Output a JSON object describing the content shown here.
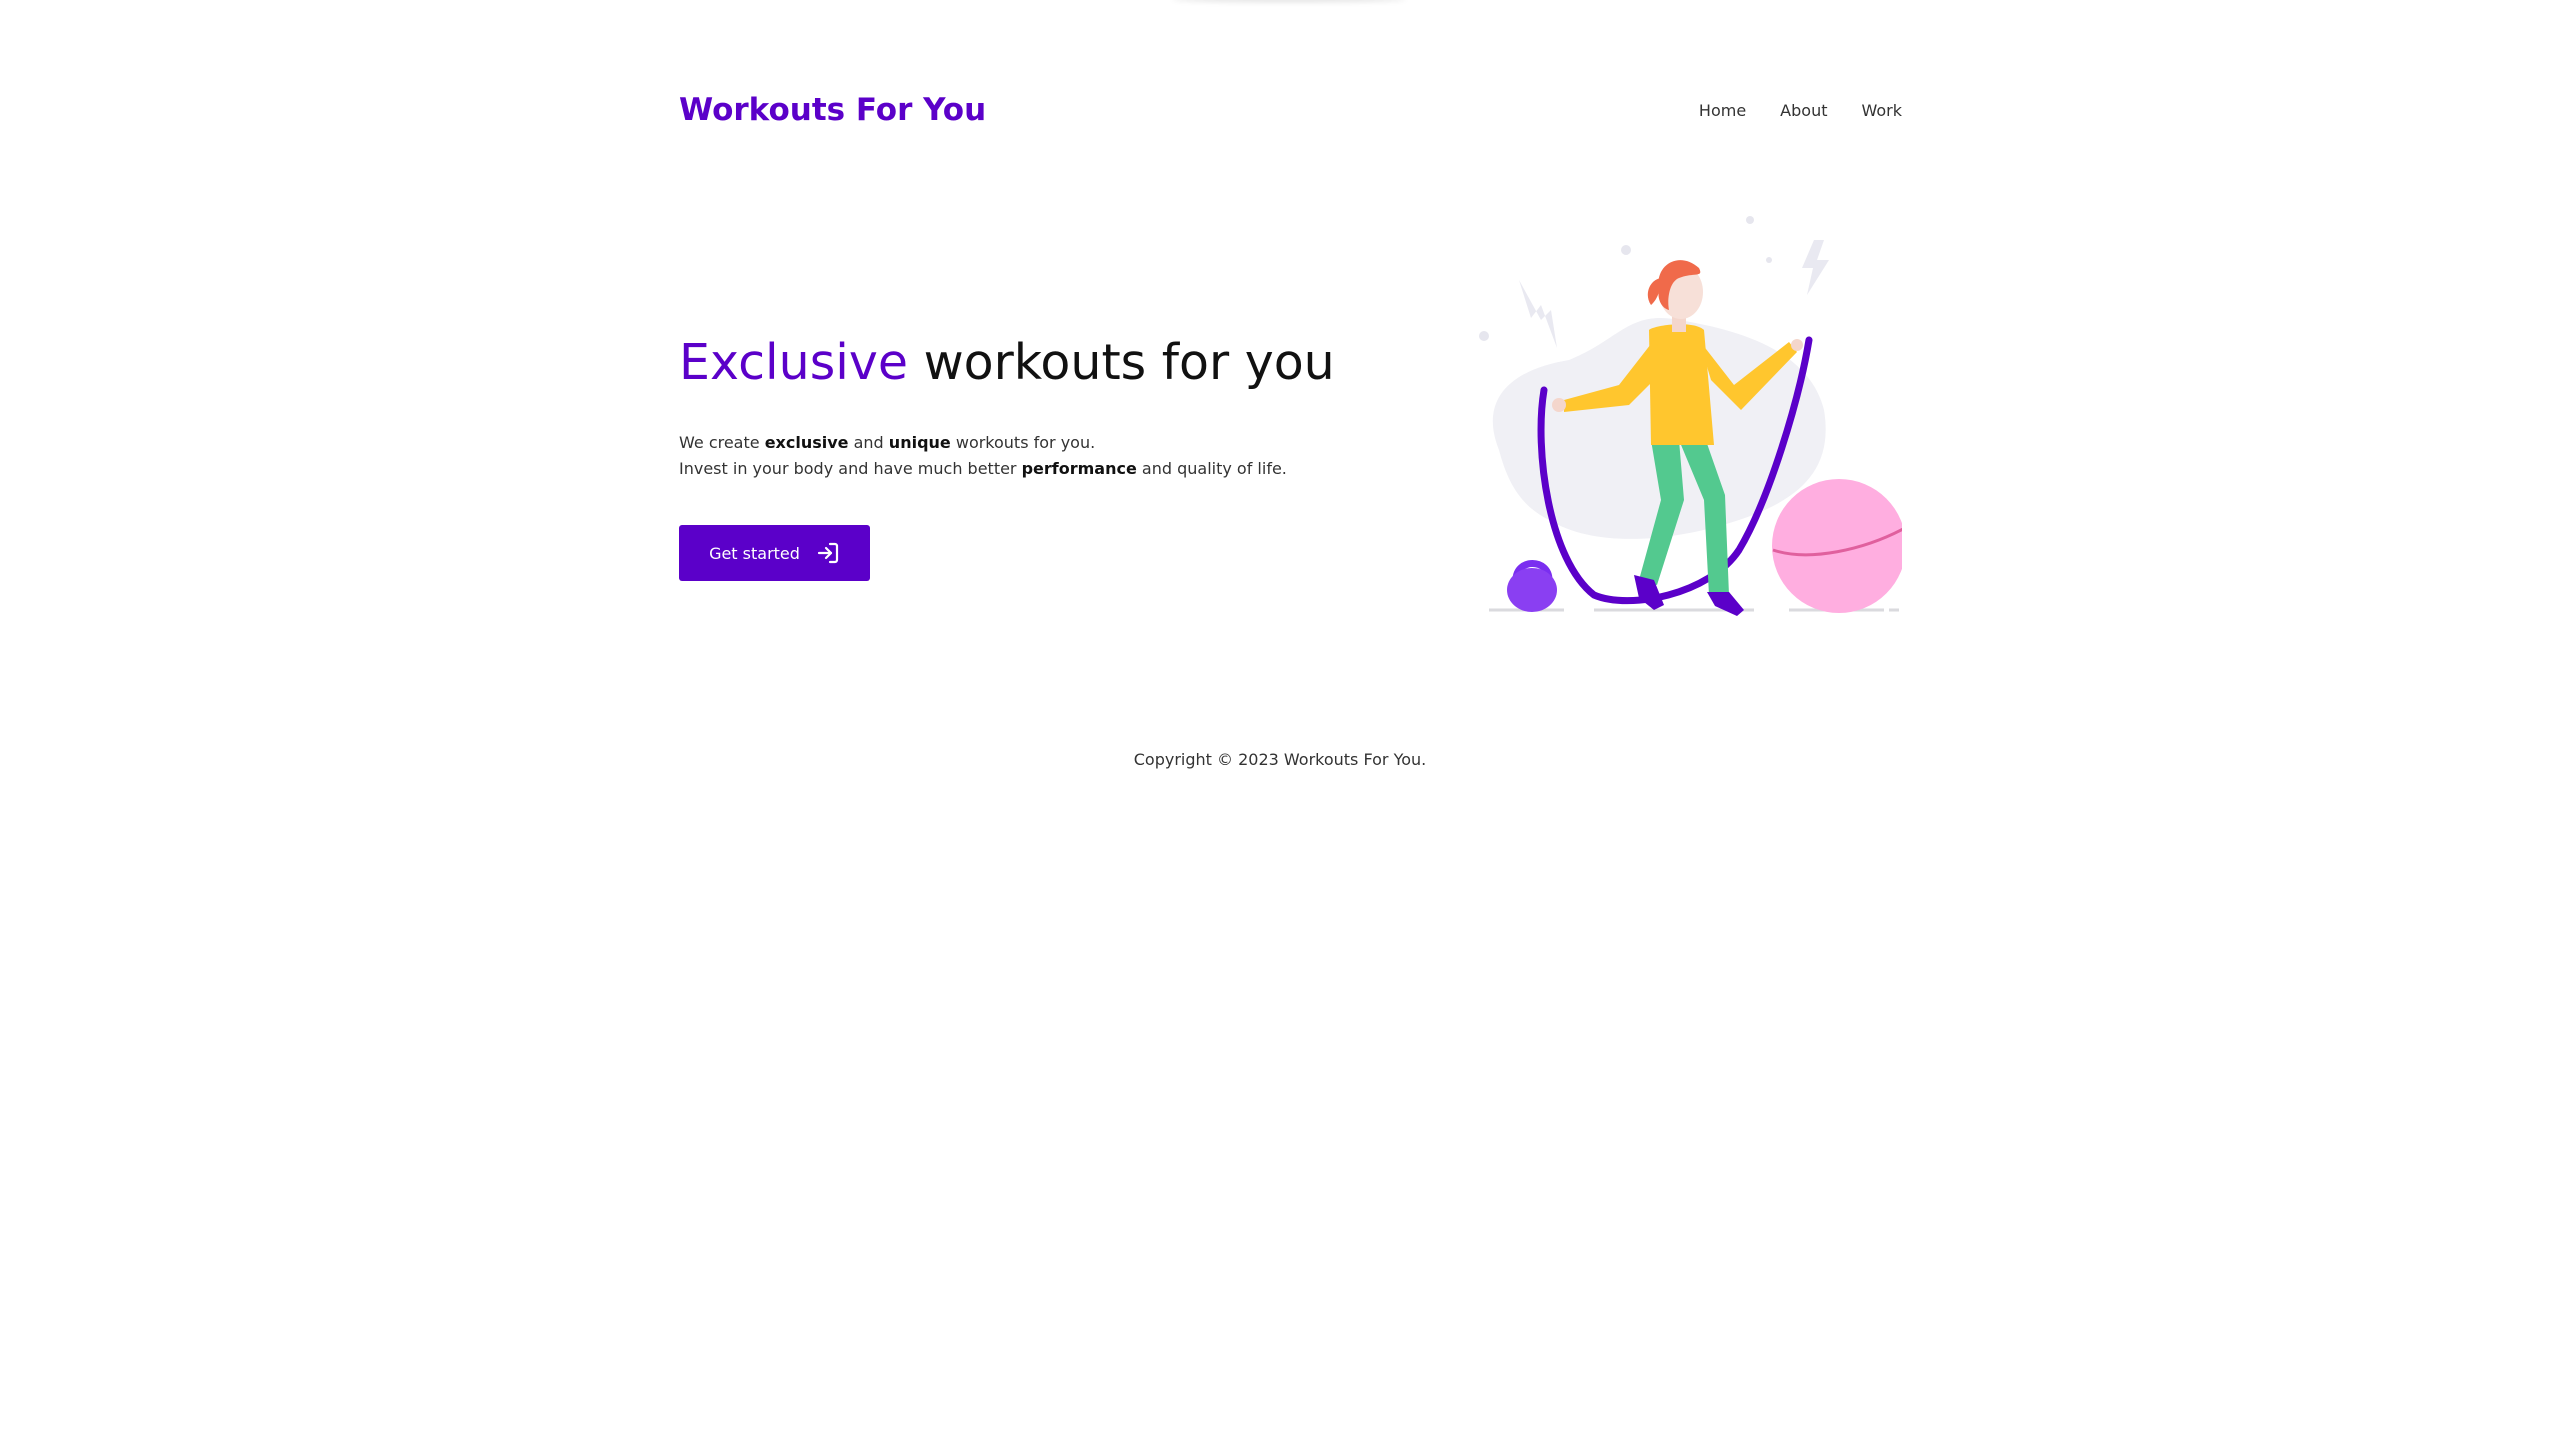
{
  "header": {
    "logo": "Workouts For You",
    "nav": [
      "Home",
      "About",
      "Work"
    ]
  },
  "hero": {
    "title_accent": "Exclusive",
    "title_rest": " workouts for you",
    "line1": {
      "a": "We create ",
      "b1": "exclusive",
      "c": " and ",
      "b2": "unique",
      "d": " workouts for you."
    },
    "line2": {
      "a": "Invest in your body and have much better ",
      "b": "performance",
      "c": " and quality of life."
    },
    "cta_label": "Get started",
    "cta_icon": "sign-in-icon",
    "illustration": "woman-jump-rope-illustration"
  },
  "footer": {
    "copyright": "Copyright © 2023 Workouts For You."
  },
  "colors": {
    "brand": "#5b00c9",
    "text": "#333333",
    "background": "#ffffff"
  }
}
